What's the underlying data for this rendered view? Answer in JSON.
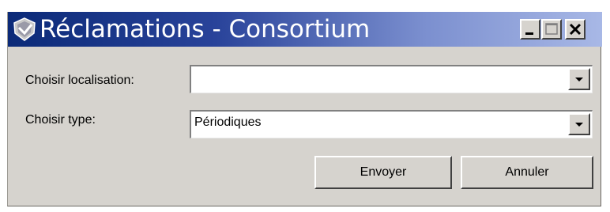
{
  "window": {
    "title": "Réclamations - Consortium",
    "icon": "app-shield-icon",
    "controls": {
      "minimize": "minimize-icon",
      "maximize": "maximize-icon",
      "close": "close-icon"
    }
  },
  "form": {
    "location_label": "Choisir localisation:",
    "location_value": "",
    "type_label": "Choisir type:",
    "type_value": "Périodiques"
  },
  "buttons": {
    "send_label": "Envoyer",
    "cancel_label": "Annuler"
  },
  "colors": {
    "titlebar_start": "#0b2a78",
    "titlebar_end": "#a8b8e6",
    "window_bg": "#d6d3ce"
  }
}
